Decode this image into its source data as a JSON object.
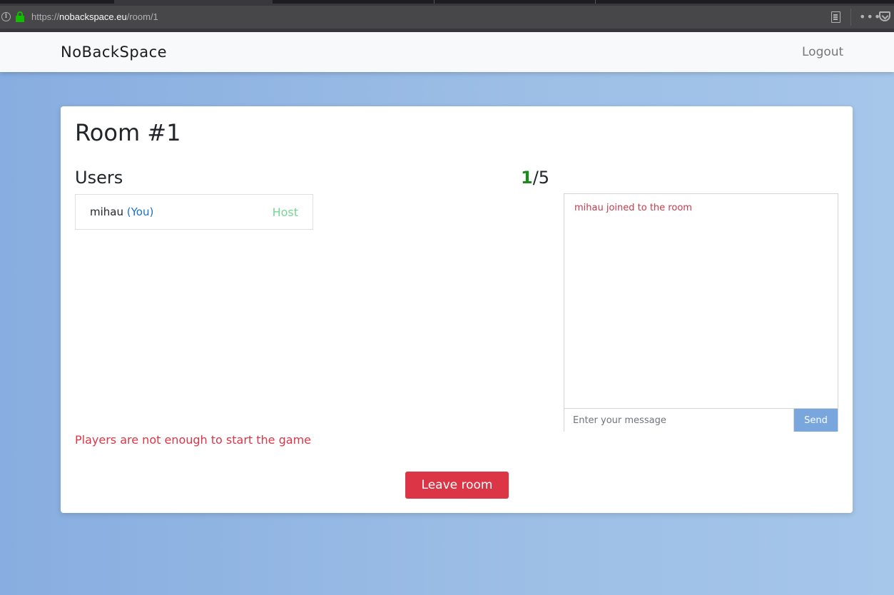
{
  "browser": {
    "url_scheme": "https://",
    "url_host": "nobackspace.eu",
    "url_path": "/room/1",
    "more_label": "•••"
  },
  "navbar": {
    "brand": "NoBackSpace",
    "logout": "Logout"
  },
  "room": {
    "title": "Room #1",
    "users_heading": "Users",
    "player_count_current": "1",
    "player_count_max": "/5",
    "users": [
      {
        "name": "mihau",
        "you_tag": "(You)",
        "role": "Host"
      }
    ],
    "status_message": "Players are not enough to start the game",
    "leave_button": "Leave room"
  },
  "chat": {
    "messages": [
      {
        "text": "mihau joined to the room"
      }
    ],
    "input_placeholder": "Enter your message",
    "input_value": "",
    "send_button": "Send"
  },
  "colors": {
    "host_role": "#76d596",
    "you_tag": "#1a6fd1",
    "danger": "#dc3545",
    "send_button": "#79a6dc",
    "count_current": "#1e8a1e"
  }
}
